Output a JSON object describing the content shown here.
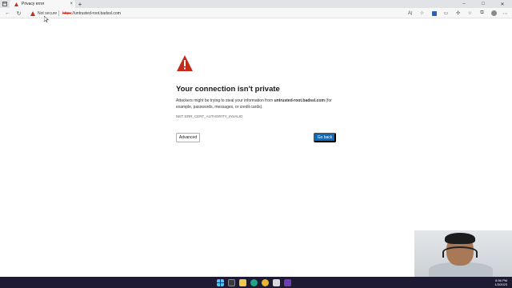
{
  "browser": {
    "tab": {
      "title": "Privacy error"
    },
    "window_controls": {
      "minimize": "–",
      "maximize": "□",
      "close": "✕"
    },
    "toolbar": {
      "security_label": "Not secure",
      "url_scheme": "https",
      "url_rest": "://untrusted-root.badssl.com"
    }
  },
  "page": {
    "heading": "Your connection isn't private",
    "message_prefix": "Attackers might be trying to steal your information from ",
    "message_host": "untrusted-root.badssl.com",
    "message_suffix": " (for example, passwords, messages, or credit cards).",
    "error_code": "NET::ERR_CERT_AUTHORITY_INVALID",
    "advanced_button": "Advanced",
    "back_button": "Go back"
  },
  "taskbar": {
    "time": "8:36 PM",
    "date": "1/3/2023"
  },
  "colors": {
    "warning": "#c42b1c",
    "primary_button": "#0f6cbd",
    "taskbar": "#1f1a33"
  }
}
